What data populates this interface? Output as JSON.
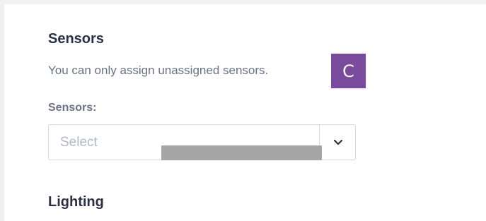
{
  "sensors_section": {
    "title": "Sensors",
    "helper_text": "You can only assign unassigned sensors.",
    "field_label": "Sensors:",
    "select": {
      "placeholder": "Select"
    }
  },
  "avatar": {
    "initial": "C",
    "color": "#7a4a9c"
  },
  "lighting_section": {
    "title": "Lighting"
  },
  "icons": {
    "select_toggle": "chevron-down-icon"
  }
}
